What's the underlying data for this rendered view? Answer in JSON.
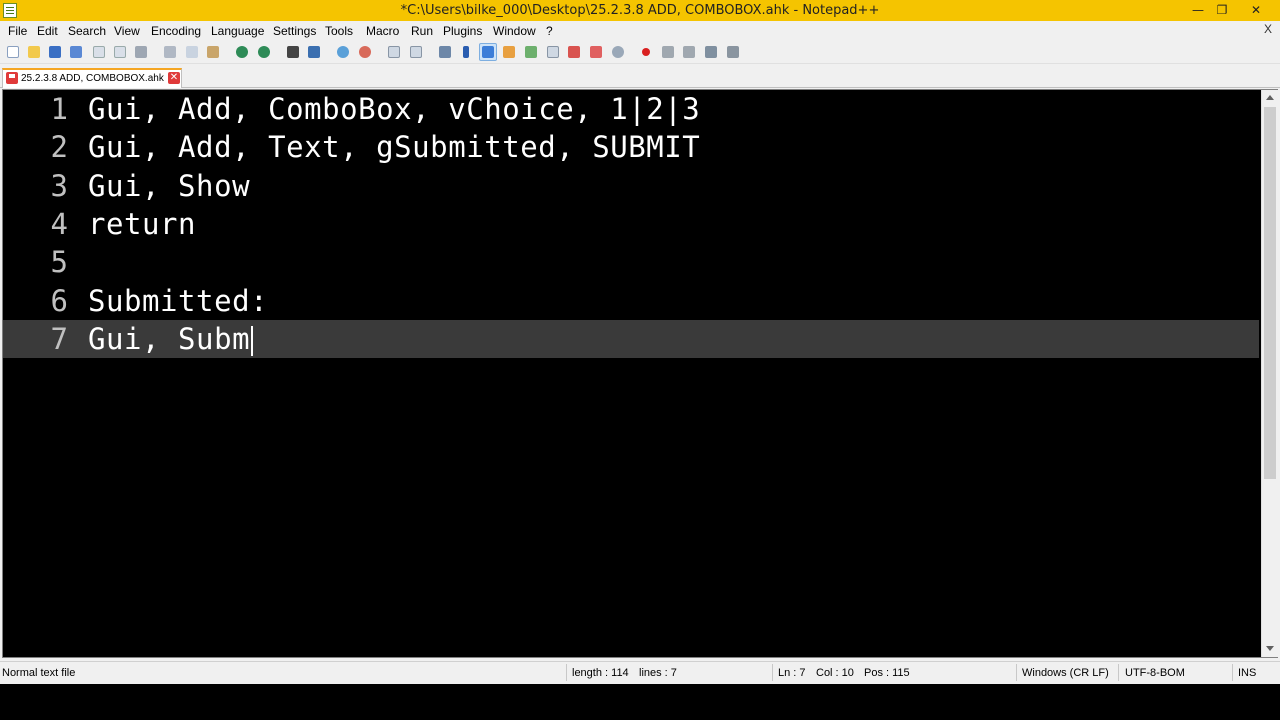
{
  "window": {
    "title": "*C:\\Users\\bilke_000\\Desktop\\25.2.3.8 ADD, COMBOBOX.ahk - Notepad++",
    "minimize": "—",
    "maximize": "❐",
    "close": "✕"
  },
  "menu": {
    "items": [
      "File",
      "Edit",
      "Search",
      "View",
      "Encoding",
      "Language",
      "Settings",
      "Tools",
      "Macro",
      "Run",
      "Plugins",
      "Window",
      "?"
    ],
    "close_doc": "X"
  },
  "toolbar": {
    "icons": [
      "new-file-icon",
      "open-file-icon",
      "save-icon",
      "save-all-icon",
      "close-icon",
      "close-all-icon",
      "print-icon",
      "cut-icon",
      "copy-icon",
      "paste-icon",
      "undo-icon",
      "redo-icon",
      "find-icon",
      "replace-icon",
      "zoom-in-icon",
      "zoom-out-icon",
      "sync-vertical-icon",
      "sync-horizontal-icon",
      "word-wrap-icon",
      "show-all-chars-icon",
      "indent-guide-icon",
      "user-language-icon",
      "doc-map-icon",
      "function-list-icon",
      "folder-workspace-icon",
      "monitoring-icon",
      "record-macro-icon",
      "stop-record-icon",
      "playback-macro-icon",
      "run-macro-multiple-icon",
      "save-macro-icon"
    ]
  },
  "tab": {
    "label": "25.2.3.8 ADD, COMBOBOX.ahk",
    "close": "✕"
  },
  "editor": {
    "lines": [
      {
        "num": "1",
        "code": "Gui, Add, ComboBox, vChoice, 1|2|3"
      },
      {
        "num": "2",
        "code": "Gui, Add, Text, gSubmitted, SUBMIT"
      },
      {
        "num": "3",
        "code": "Gui, Show"
      },
      {
        "num": "4",
        "code": "return"
      },
      {
        "num": "5",
        "code": ""
      },
      {
        "num": "6",
        "code": "Submitted:"
      },
      {
        "num": "7",
        "code": "Gui, Subm"
      }
    ],
    "current_line": 7
  },
  "status": {
    "file_type": "Normal text file",
    "length": "length : 114",
    "lines": "lines : 7",
    "ln": "Ln : 7",
    "col": "Col : 10",
    "pos": "Pos : 115",
    "eol": "Windows (CR LF)",
    "encoding": "UTF-8-BOM",
    "mode": "INS"
  },
  "colors": {
    "titlebar": "#f5c400",
    "editor_bg": "#000000",
    "current_line": "#3a3a3a",
    "code_text": "#ffffff"
  }
}
